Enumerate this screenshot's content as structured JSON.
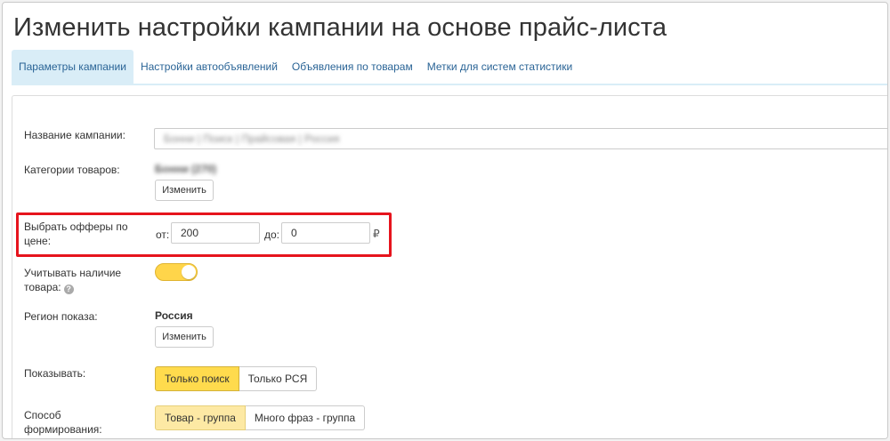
{
  "page": {
    "title": "Изменить настройки кампании на основе прайс-листа"
  },
  "tabs": [
    {
      "label": "Параметры кампании",
      "active": true
    },
    {
      "label": "Настройки автообъявлений",
      "active": false
    },
    {
      "label": "Объявления по товарам",
      "active": false
    },
    {
      "label": "Метки для систем статистики",
      "active": false
    }
  ],
  "form": {
    "campaign_name": {
      "label": "Название кампании:",
      "value": "Бонни | Поиск | Прайсовая | Россия"
    },
    "categories": {
      "label": "Категории товаров:",
      "value": "Бонни (270)",
      "button": "Изменить"
    },
    "price_filter": {
      "label": "Выбрать офферы по цене:",
      "from_label": "от:",
      "from_value": "200",
      "to_label": "до:",
      "to_value": "0",
      "currency": "₽"
    },
    "stock": {
      "label": "Учитывать наличие товара:",
      "enabled": true,
      "help_icon": "question-circle-icon"
    },
    "region": {
      "label": "Регион показа:",
      "value": "Россия",
      "button": "Изменить"
    },
    "show": {
      "label": "Показывать:",
      "options": [
        "Только поиск",
        "Только РСЯ"
      ],
      "selected": "Только поиск"
    },
    "formation": {
      "label": "Способ формирования:",
      "options": [
        "Товар - группа",
        "Много фраз - группа"
      ],
      "selected": "Товар - группа"
    }
  },
  "colors": {
    "highlight": "#e6141d",
    "toggle_on": "#ffd54a",
    "tab_active_bg": "#d9edf7",
    "link": "#2a6496"
  }
}
